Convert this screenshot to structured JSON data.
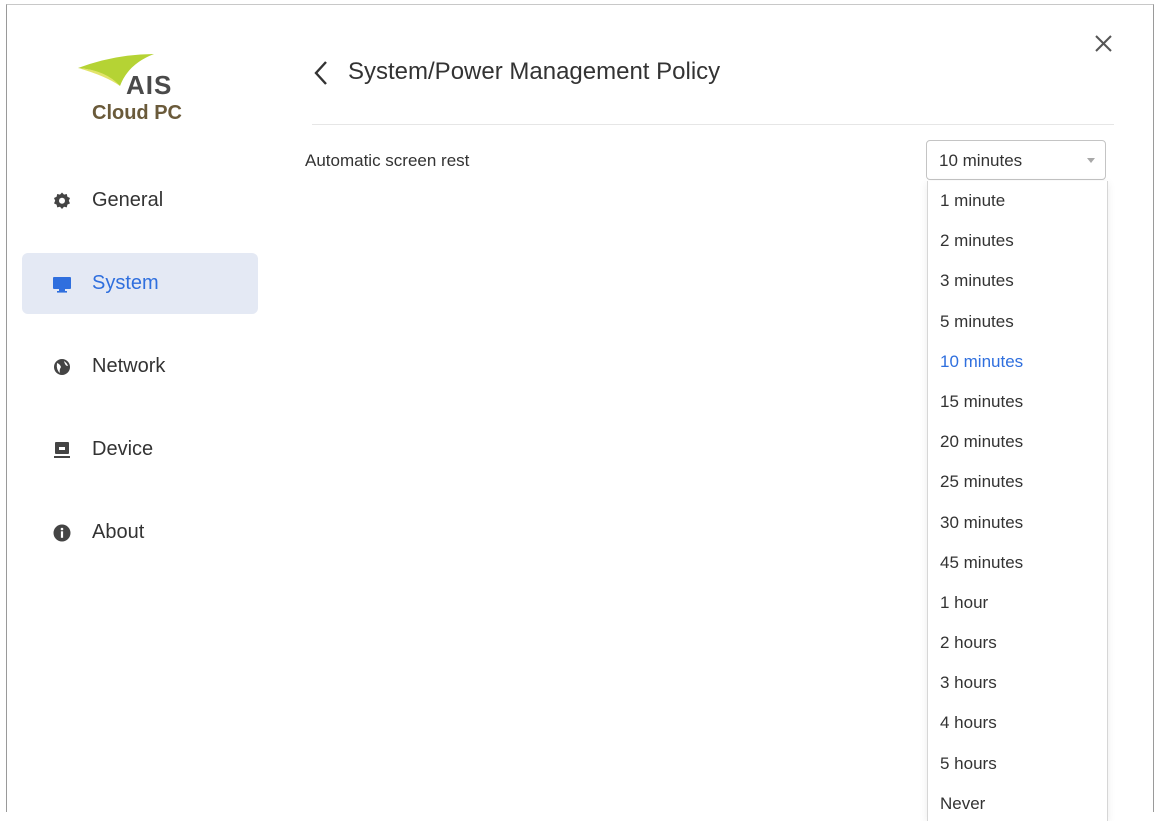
{
  "app": {
    "logo_brand": "AIS",
    "logo_product": "Cloud PC"
  },
  "sidebar": {
    "items": [
      {
        "label": "General",
        "icon": "gear-icon",
        "active": false
      },
      {
        "label": "System",
        "icon": "monitor-icon",
        "active": true
      },
      {
        "label": "Network",
        "icon": "globe-icon",
        "active": false
      },
      {
        "label": "Device",
        "icon": "device-icon",
        "active": false
      },
      {
        "label": "About",
        "icon": "info-icon",
        "active": false
      }
    ]
  },
  "header": {
    "title": "System/Power Management Policy",
    "back_icon": "chevron-left-icon",
    "close_icon": "close-icon"
  },
  "setting": {
    "label": "Automatic screen rest",
    "selected_value": "10 minutes",
    "options": [
      "1 minute",
      "2 minutes",
      "3 minutes",
      "5 minutes",
      "10 minutes",
      "15 minutes",
      "20 minutes",
      "25 minutes",
      "30 minutes",
      "45 minutes",
      "1 hour",
      "2 hours",
      "3 hours",
      "4 hours",
      "5 hours",
      "Never"
    ]
  },
  "colors": {
    "accent": "#2f6fde",
    "active_bg": "#e4e9f4",
    "text": "#333333",
    "logo_green": "#8cc63f",
    "logo_yellow": "#d7df23"
  }
}
